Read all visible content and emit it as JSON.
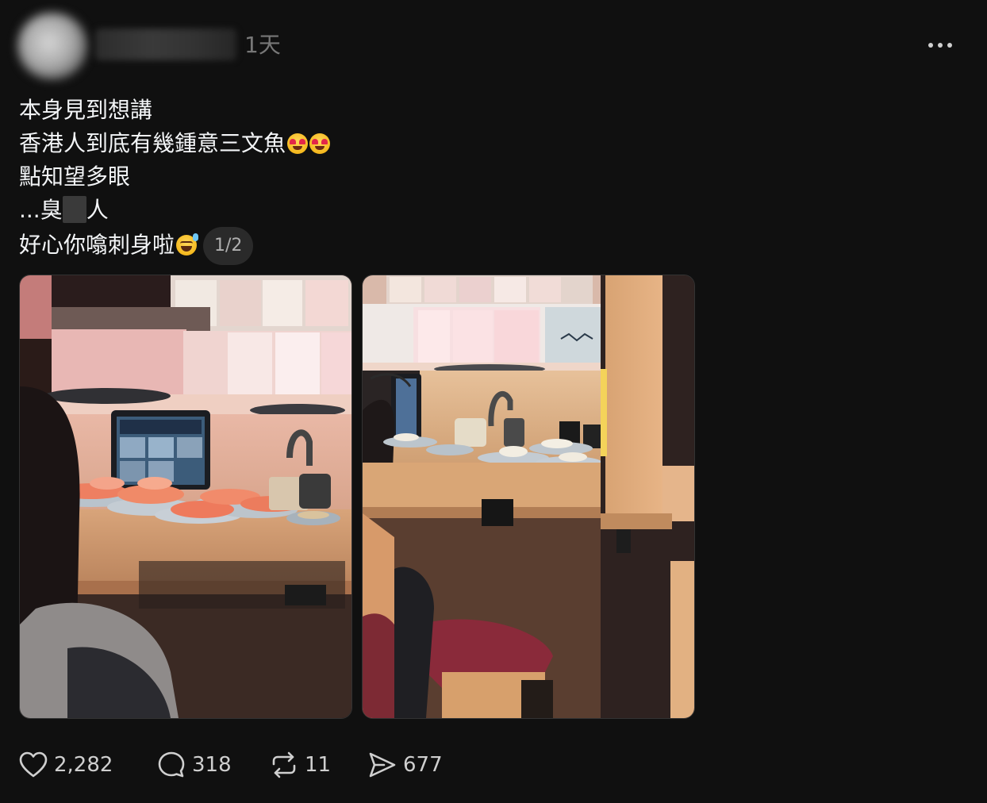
{
  "post": {
    "time_ago": "1天",
    "lines": [
      "本身見到想講",
      "香港人到底有幾鍾意三文魚",
      "點知望多眼",
      "...臭",
      "人",
      "好心你噏刺身啦"
    ],
    "pager": "1/2",
    "images": [
      {
        "icon": "sushi-counter-photo-1"
      },
      {
        "icon": "sushi-counter-photo-2"
      }
    ]
  },
  "actions": {
    "likes": "2,282",
    "comments": "318",
    "reposts": "11",
    "shares": "677"
  },
  "icons": {
    "like": "heart-icon",
    "comment": "comment-icon",
    "repost": "repost-icon",
    "share": "send-icon",
    "more": "more-icon"
  },
  "colors": {
    "background": "#101010",
    "text": "#f3f5f7",
    "muted": "#777777"
  }
}
